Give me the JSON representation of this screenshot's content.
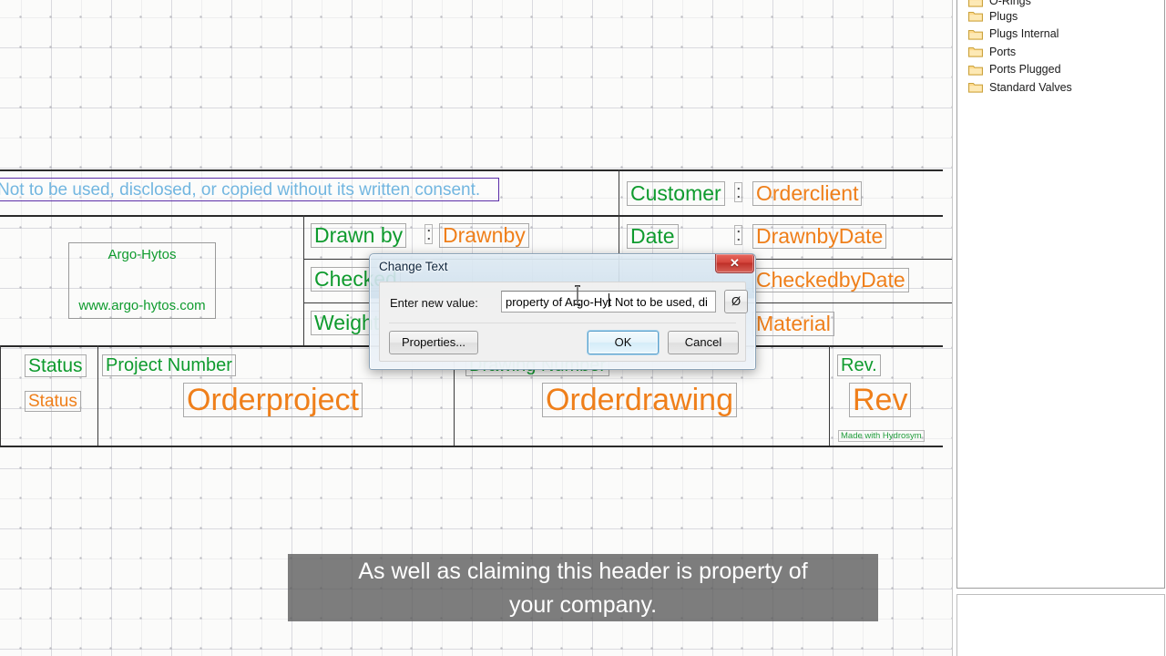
{
  "canvas": {
    "selected_text": "Not to be used, disclosed, or copied without its written consent.",
    "logo": {
      "name": "Argo-Hytos",
      "url": "www.argo-hytos.com"
    },
    "watermark": "Made with Hydrosym",
    "colon_glyph": ":",
    "fields": [
      {
        "label": "Customer",
        "value": "Orderclient"
      },
      {
        "label": "Drawn by",
        "value": "Drawnby"
      },
      {
        "label": "Date",
        "value": "DrawnbyDate"
      },
      {
        "label": "Checked",
        "value": "CheckedbyDate"
      },
      {
        "label": "Weight",
        "value": "Material"
      },
      {
        "label": "Status",
        "value": "Status"
      },
      {
        "label": "Project Number",
        "value": "Orderproject"
      },
      {
        "label": "Drawing Number",
        "value": "Orderdrawing"
      },
      {
        "label": "Rev.",
        "value": "Rev"
      }
    ],
    "colors": {
      "label": "#0f9b2e",
      "value": "#ef7f1a",
      "selection": "#5c2ea8",
      "selected_text": "#72b6e0"
    }
  },
  "dialog": {
    "title": "Change Text",
    "close_label": "✕",
    "field_label": "Enter new value:",
    "input_value": "property of Argo-Hyt Not to be used, di",
    "input_placeholder": "",
    "diameter_button": "Ø",
    "buttons": {
      "properties": "Properties...",
      "ok": "OK",
      "cancel": "Cancel"
    }
  },
  "tree": {
    "items": [
      {
        "label": "O-Rings"
      },
      {
        "label": "Plugs"
      },
      {
        "label": "Plugs Internal"
      },
      {
        "label": "Ports"
      },
      {
        "label": "Ports Plugged"
      },
      {
        "label": "Standard Valves"
      }
    ]
  },
  "caption": {
    "text": "As well as claiming this header is property of\nyour company."
  }
}
